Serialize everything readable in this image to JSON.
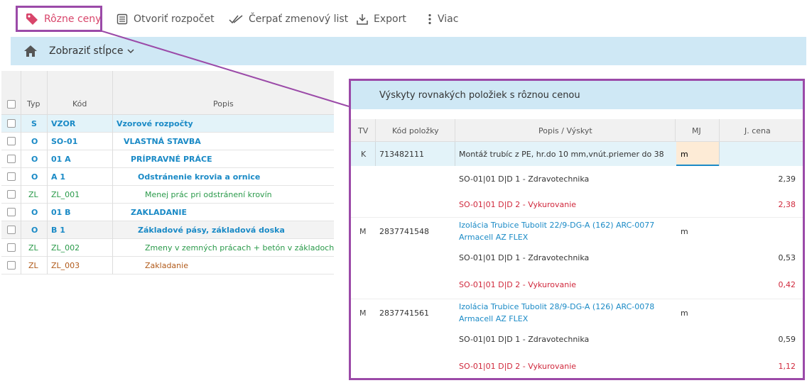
{
  "toolbar": {
    "rozne_ceny": "Rôzne ceny",
    "otvorit": "Otvoriť rozpočet",
    "cerpat": "Čerpať zmenový list",
    "export": "Export",
    "viac": "Viac"
  },
  "bar": {
    "zobrazit": "Zobraziť stĺpce"
  },
  "left": {
    "headers": {
      "typ": "Typ",
      "kod": "Kód",
      "popis": "Popis"
    },
    "rows": [
      {
        "typ": "S",
        "kod": "VZOR",
        "popis": "Vzorové rozpočty"
      },
      {
        "typ": "O",
        "kod": "SO-01",
        "popis": "VLASTNÁ STAVBA"
      },
      {
        "typ": "O",
        "kod": "01 A",
        "popis": "PRÍPRAVNÉ PRÁCE"
      },
      {
        "typ": "O",
        "kod": "A 1",
        "popis": "Odstránenie krovia a ornice"
      },
      {
        "typ": "ZL",
        "kod": "ZL_001",
        "popis": "Menej prác pri odstránení krovín"
      },
      {
        "typ": "O",
        "kod": "01 B",
        "popis": "ZAKLADANIE"
      },
      {
        "typ": "O",
        "kod": "B 1",
        "popis": "Základové pásy, základová doska"
      },
      {
        "typ": "ZL",
        "kod": "ZL_002",
        "popis": "Zmeny v zemných prácach + betón v základoch"
      },
      {
        "typ": "ZL",
        "kod": "ZL_003",
        "popis": "Zakladanie"
      }
    ]
  },
  "panel": {
    "title": "Výskyty rovnakých položiek s rôznou cenou",
    "headers": {
      "tv": "TV",
      "kod": "Kód položky",
      "popis": "Popis / Výskyt",
      "mj": "MJ",
      "cena": "J. cena"
    },
    "items": [
      {
        "tv": "K",
        "kod": "713482111",
        "popis1": "Montáž trubíc z PE, hr.do 10 mm,vnút.priemer do 38",
        "popis2": "",
        "mj": "m",
        "sub": [
          {
            "text": "SO-01|01 D|D 1 - Zdravotechnika",
            "cena": "2,39"
          },
          {
            "text": "SO-01|01 D|D 2 - Vykurovanie",
            "cena": "2,38"
          }
        ]
      },
      {
        "tv": "M",
        "kod": "2837741548",
        "popis1": "Izolácia Trubice Tubolit 22/9-DG-A (162) ARC-0077",
        "popis2": "Armacell AZ FLEX",
        "mj": "m",
        "sub": [
          {
            "text": "SO-01|01 D|D 1 - Zdravotechnika",
            "cena": "0,53"
          },
          {
            "text": "SO-01|01 D|D 2 - Vykurovanie",
            "cena": "0,42"
          }
        ]
      },
      {
        "tv": "M",
        "kod": "2837741561",
        "popis1": "Izolácia Trubice Tubolit 28/9-DG-A (126) ARC-0078",
        "popis2": "Armacell AZ FLEX",
        "mj": "m",
        "sub": [
          {
            "text": "SO-01|01 D|D 1 - Zdravotechnika",
            "cena": "0,59"
          },
          {
            "text": "SO-01|01 D|D 2 - Vykurovanie",
            "cena": "1,12"
          }
        ]
      }
    ]
  },
  "colors": {
    "accent": "#9b4aa8",
    "tag": "#d8456b",
    "blue": "#1a8ac6",
    "highlight_bg": "#cfe8f5"
  }
}
